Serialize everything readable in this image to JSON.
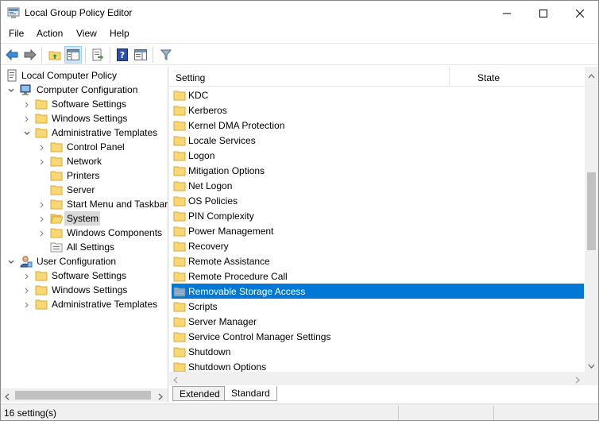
{
  "window": {
    "title": "Local Group Policy Editor"
  },
  "menu": {
    "items": [
      "File",
      "Action",
      "View",
      "Help"
    ]
  },
  "toolbar": {
    "buttons": [
      "back-arrow-icon",
      "forward-arrow-icon",
      "up-folder-icon",
      "show-hide-tree-icon",
      "export-list-icon",
      "help-icon",
      "properties-pane-icon",
      "filter-icon"
    ]
  },
  "tree": {
    "root": "Local Computer Policy",
    "computer_config": "Computer Configuration",
    "cc_software": "Software Settings",
    "cc_windows": "Windows Settings",
    "cc_admin": "Administrative Templates",
    "at_control_panel": "Control Panel",
    "at_network": "Network",
    "at_printers": "Printers",
    "at_server": "Server",
    "at_start_menu": "Start Menu and Taskbar",
    "at_system": "System",
    "at_windows_components": "Windows Components",
    "at_all_settings": "All Settings",
    "user_config": "User Configuration",
    "uc_software": "Software Settings",
    "uc_windows": "Windows Settings",
    "uc_admin": "Administrative Templates"
  },
  "list": {
    "columns": {
      "setting": "Setting",
      "state": "State"
    },
    "items": [
      "KDC",
      "Kerberos",
      "Kernel DMA Protection",
      "Locale Services",
      "Logon",
      "Mitigation Options",
      "Net Logon",
      "OS Policies",
      "PIN Complexity",
      "Power Management",
      "Recovery",
      "Remote Assistance",
      "Remote Procedure Call",
      "Removable Storage Access",
      "Scripts",
      "Server Manager",
      "Service Control Manager Settings",
      "Shutdown",
      "Shutdown Options"
    ],
    "selected": "Removable Storage Access"
  },
  "tabs": {
    "extended": "Extended",
    "standard": "Standard",
    "active": "Standard"
  },
  "status": {
    "text": "16 setting(s)"
  },
  "colors": {
    "selection": "#0078d7",
    "folder": "#f8d775",
    "folder_edge": "#d9a934"
  }
}
